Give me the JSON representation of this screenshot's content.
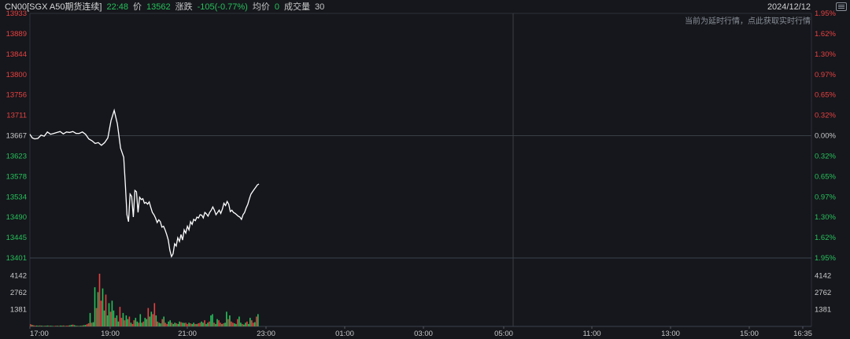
{
  "header": {
    "instrument": "CN00[SGX A50期货连续]",
    "time": "22:48",
    "price_label": "价",
    "price": "13562",
    "change_label": "涨跌",
    "change": "-105(-0.77%)",
    "avg_label": "均价",
    "avg": "0",
    "volume_label": "成交量",
    "volume": "30",
    "date": "2024/12/12"
  },
  "note": "当前为延时行情，点此获取实时行情",
  "icons": {
    "menu": "menu-icon"
  },
  "colors": {
    "background": "#15171c",
    "grid": "#2e323a",
    "up": "#e84040",
    "down": "#27c05a",
    "price_line": "#ffffff",
    "neutral_label": "#c8c8c8"
  },
  "chart_data": [
    {
      "type": "line",
      "series": [
        {
          "values_x_minutes": [
            0,
            3,
            6,
            10,
            14,
            18,
            22,
            26,
            30,
            34,
            38,
            42,
            46,
            50,
            54,
            58,
            62,
            66,
            70,
            74,
            78,
            82,
            86,
            90,
            94,
            98,
            102,
            106,
            110,
            114,
            118,
            120,
            122,
            124,
            125,
            126,
            128,
            130,
            132,
            134,
            136,
            138,
            140,
            142,
            144,
            146,
            148,
            150,
            152,
            154,
            156,
            158,
            160,
            162,
            164,
            166,
            168,
            170,
            172,
            174,
            176,
            178,
            180,
            182,
            184,
            186,
            188,
            190,
            192,
            194,
            196,
            198,
            200,
            202,
            204,
            206,
            208,
            210,
            212,
            214,
            216,
            218,
            220,
            222,
            224,
            226,
            228,
            230,
            232,
            234,
            236,
            238,
            240,
            242,
            244,
            246,
            248,
            250,
            252,
            254,
            256,
            258,
            260,
            262,
            264,
            266,
            268,
            270,
            272,
            274,
            276,
            278,
            280,
            282,
            284,
            286,
            288
          ],
          "values": [
            13670,
            13662,
            13660,
            13661,
            13668,
            13666,
            13675,
            13670,
            13672,
            13674,
            13676,
            13671,
            13675,
            13674,
            13676,
            13672,
            13672,
            13675,
            13670,
            13660,
            13656,
            13650,
            13652,
            13646,
            13652,
            13662,
            13700,
            13722,
            13693,
            13640,
            13620,
            13560,
            13495,
            13480,
            13510,
            13540,
            13535,
            13490,
            13548,
            13545,
            13500,
            13533,
            13528,
            13530,
            13520,
            13522,
            13518,
            13523,
            13511,
            13500,
            13495,
            13488,
            13478,
            13484,
            13480,
            13468,
            13470,
            13462,
            13452,
            13440,
            13418,
            13404,
            13410,
            13432,
            13427,
            13445,
            13437,
            13452,
            13440,
            13462,
            13455,
            13470,
            13462,
            13480,
            13474,
            13485,
            13482,
            13490,
            13488,
            13495,
            13494,
            13488,
            13500,
            13497,
            13492,
            13500,
            13505,
            13512,
            13505,
            13495,
            13500,
            13505,
            13498,
            13507,
            13520,
            13515,
            13524,
            13518,
            13502,
            13505,
            13500,
            13498,
            13495,
            13492,
            13490,
            13485,
            13495,
            13500,
            13510,
            13518,
            13530,
            13540,
            13545,
            13550,
            13555,
            13560,
            13562
          ]
        }
      ],
      "prev_close": 13667,
      "ylim": [
        13401,
        13933
      ],
      "y_ticks_left": [
        "13933",
        "13889",
        "13844",
        "13800",
        "13756",
        "13711",
        "13667",
        "13623",
        "13578",
        "13534",
        "13490",
        "13445",
        "13401"
      ],
      "y_ticks_right": [
        "1.95%",
        "1.62%",
        "1.30%",
        "0.97%",
        "0.65%",
        "0.32%",
        "0.00%",
        "0.32%",
        "0.65%",
        "0.97%",
        "1.30%",
        "1.62%",
        "1.95%"
      ],
      "grid": true
    },
    {
      "type": "bar",
      "volume_values": [
        180,
        120,
        90,
        60,
        70,
        50,
        80,
        60,
        40,
        50,
        60,
        70,
        50,
        60,
        40,
        30,
        50,
        60,
        40,
        70,
        60,
        80,
        40,
        60,
        70,
        90,
        120,
        150,
        100,
        60,
        50,
        40,
        60,
        80,
        100,
        120,
        180,
        260,
        1100,
        300,
        350,
        3200,
        1500,
        2800,
        4300,
        2100,
        3100,
        1300,
        2600,
        900,
        1900,
        1200,
        2100,
        1300,
        700,
        900,
        400,
        1600,
        700,
        1100,
        500,
        900,
        600,
        800,
        300,
        200,
        500,
        700,
        400,
        300,
        1000,
        300,
        400,
        700,
        600,
        1500,
        800,
        1200,
        1000,
        1900,
        900,
        400,
        300,
        250,
        600,
        800,
        300,
        200,
        400,
        500,
        300,
        200,
        300,
        250,
        200,
        400,
        350,
        300,
        280,
        300,
        200,
        300,
        250,
        200,
        300,
        200,
        200,
        250,
        300,
        400,
        300,
        500,
        200,
        300,
        400,
        900,
        1000,
        300,
        200,
        600,
        500,
        300,
        200,
        250,
        300,
        1200,
        600,
        900,
        400,
        300,
        250,
        200,
        600,
        800,
        300,
        200,
        150,
        300,
        400,
        200,
        700,
        500,
        300,
        350,
        800,
        1000
      ],
      "volume_ylim": [
        0,
        5523
      ],
      "y_ticks_left": [
        "4142",
        "2762",
        "1381"
      ],
      "y_ticks_right": [
        "4142",
        "2762",
        "1381"
      ],
      "x_ticks": [
        "17:00",
        "19:00",
        "21:00",
        "23:00",
        "01:00",
        "03:00",
        "05:00",
        "11:00",
        "13:00",
        "15:00",
        "16:35"
      ],
      "grid": true
    }
  ]
}
